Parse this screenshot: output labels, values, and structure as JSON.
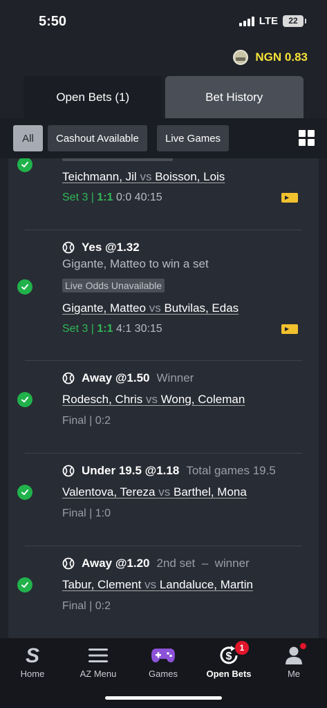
{
  "status_bar": {
    "time": "5:50",
    "network": "LTE",
    "battery": "22"
  },
  "balance": {
    "text": "NGN 0.83"
  },
  "tabs": [
    {
      "label": "Open Bets (1)"
    },
    {
      "label": "Bet History"
    }
  ],
  "filters": [
    {
      "label": "All"
    },
    {
      "label": "Cashout Available"
    },
    {
      "label": "Live Games"
    }
  ],
  "bets": [
    {
      "home": "Teichmann, Jil",
      "vs": "vs",
      "away": "Boisson, Lois",
      "score_prefix": "Set 3 | ",
      "score_bold": "1:1",
      "score_rest": " 0:0 40:15"
    },
    {
      "pick": "Yes @1.32",
      "subline": "Gigante, Matteo to win a set",
      "badge": "Live Odds Unavailable",
      "home": "Gigante, Matteo",
      "vs": "vs",
      "away": "Butvilas, Edas",
      "score_prefix": "Set 3 | ",
      "score_bold": "1:1",
      "score_rest": " 4:1 30:15"
    },
    {
      "pick": "Away @1.50",
      "market": "Winner",
      "home": "Rodesch, Chris",
      "vs": "vs",
      "away": "Wong, Coleman",
      "score": "Final | 0:2"
    },
    {
      "pick": "Under 19.5 @1.18",
      "market": "Total games 19.5",
      "home": "Valentova, Tereza",
      "vs": "vs",
      "away": "Barthel, Mona",
      "score": "Final | 1:0"
    },
    {
      "pick": "Away @1.20",
      "market": "2nd set  –  winner",
      "home": "Tabur, Clement",
      "vs": "vs",
      "away": "Landaluce, Martin",
      "score": "Final | 0:2"
    }
  ],
  "bottom_nav": [
    {
      "label": "Home"
    },
    {
      "label": "AZ Menu"
    },
    {
      "label": "Games"
    },
    {
      "label": "Open Bets",
      "badge": "1"
    },
    {
      "label": "Me"
    }
  ],
  "colors": {
    "accent_yellow": "#f6e23a",
    "live_green": "#2fb857",
    "check_green": "#21b24b",
    "badge_red": "#e1152b"
  }
}
